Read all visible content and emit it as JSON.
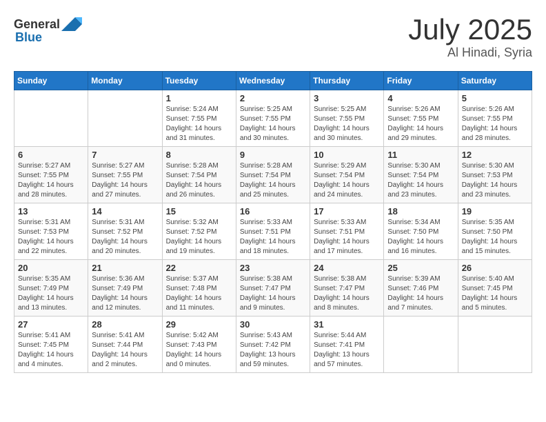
{
  "header": {
    "logo_general": "General",
    "logo_blue": "Blue",
    "month": "July 2025",
    "location": "Al Hinadi, Syria"
  },
  "weekdays": [
    "Sunday",
    "Monday",
    "Tuesday",
    "Wednesday",
    "Thursday",
    "Friday",
    "Saturday"
  ],
  "weeks": [
    [
      {
        "day": "",
        "sunrise": "",
        "sunset": "",
        "daylight": ""
      },
      {
        "day": "",
        "sunrise": "",
        "sunset": "",
        "daylight": ""
      },
      {
        "day": "1",
        "sunrise": "Sunrise: 5:24 AM",
        "sunset": "Sunset: 7:55 PM",
        "daylight": "Daylight: 14 hours and 31 minutes."
      },
      {
        "day": "2",
        "sunrise": "Sunrise: 5:25 AM",
        "sunset": "Sunset: 7:55 PM",
        "daylight": "Daylight: 14 hours and 30 minutes."
      },
      {
        "day": "3",
        "sunrise": "Sunrise: 5:25 AM",
        "sunset": "Sunset: 7:55 PM",
        "daylight": "Daylight: 14 hours and 30 minutes."
      },
      {
        "day": "4",
        "sunrise": "Sunrise: 5:26 AM",
        "sunset": "Sunset: 7:55 PM",
        "daylight": "Daylight: 14 hours and 29 minutes."
      },
      {
        "day": "5",
        "sunrise": "Sunrise: 5:26 AM",
        "sunset": "Sunset: 7:55 PM",
        "daylight": "Daylight: 14 hours and 28 minutes."
      }
    ],
    [
      {
        "day": "6",
        "sunrise": "Sunrise: 5:27 AM",
        "sunset": "Sunset: 7:55 PM",
        "daylight": "Daylight: 14 hours and 28 minutes."
      },
      {
        "day": "7",
        "sunrise": "Sunrise: 5:27 AM",
        "sunset": "Sunset: 7:55 PM",
        "daylight": "Daylight: 14 hours and 27 minutes."
      },
      {
        "day": "8",
        "sunrise": "Sunrise: 5:28 AM",
        "sunset": "Sunset: 7:54 PM",
        "daylight": "Daylight: 14 hours and 26 minutes."
      },
      {
        "day": "9",
        "sunrise": "Sunrise: 5:28 AM",
        "sunset": "Sunset: 7:54 PM",
        "daylight": "Daylight: 14 hours and 25 minutes."
      },
      {
        "day": "10",
        "sunrise": "Sunrise: 5:29 AM",
        "sunset": "Sunset: 7:54 PM",
        "daylight": "Daylight: 14 hours and 24 minutes."
      },
      {
        "day": "11",
        "sunrise": "Sunrise: 5:30 AM",
        "sunset": "Sunset: 7:54 PM",
        "daylight": "Daylight: 14 hours and 23 minutes."
      },
      {
        "day": "12",
        "sunrise": "Sunrise: 5:30 AM",
        "sunset": "Sunset: 7:53 PM",
        "daylight": "Daylight: 14 hours and 23 minutes."
      }
    ],
    [
      {
        "day": "13",
        "sunrise": "Sunrise: 5:31 AM",
        "sunset": "Sunset: 7:53 PM",
        "daylight": "Daylight: 14 hours and 22 minutes."
      },
      {
        "day": "14",
        "sunrise": "Sunrise: 5:31 AM",
        "sunset": "Sunset: 7:52 PM",
        "daylight": "Daylight: 14 hours and 20 minutes."
      },
      {
        "day": "15",
        "sunrise": "Sunrise: 5:32 AM",
        "sunset": "Sunset: 7:52 PM",
        "daylight": "Daylight: 14 hours and 19 minutes."
      },
      {
        "day": "16",
        "sunrise": "Sunrise: 5:33 AM",
        "sunset": "Sunset: 7:51 PM",
        "daylight": "Daylight: 14 hours and 18 minutes."
      },
      {
        "day": "17",
        "sunrise": "Sunrise: 5:33 AM",
        "sunset": "Sunset: 7:51 PM",
        "daylight": "Daylight: 14 hours and 17 minutes."
      },
      {
        "day": "18",
        "sunrise": "Sunrise: 5:34 AM",
        "sunset": "Sunset: 7:50 PM",
        "daylight": "Daylight: 14 hours and 16 minutes."
      },
      {
        "day": "19",
        "sunrise": "Sunrise: 5:35 AM",
        "sunset": "Sunset: 7:50 PM",
        "daylight": "Daylight: 14 hours and 15 minutes."
      }
    ],
    [
      {
        "day": "20",
        "sunrise": "Sunrise: 5:35 AM",
        "sunset": "Sunset: 7:49 PM",
        "daylight": "Daylight: 14 hours and 13 minutes."
      },
      {
        "day": "21",
        "sunrise": "Sunrise: 5:36 AM",
        "sunset": "Sunset: 7:49 PM",
        "daylight": "Daylight: 14 hours and 12 minutes."
      },
      {
        "day": "22",
        "sunrise": "Sunrise: 5:37 AM",
        "sunset": "Sunset: 7:48 PM",
        "daylight": "Daylight: 14 hours and 11 minutes."
      },
      {
        "day": "23",
        "sunrise": "Sunrise: 5:38 AM",
        "sunset": "Sunset: 7:47 PM",
        "daylight": "Daylight: 14 hours and 9 minutes."
      },
      {
        "day": "24",
        "sunrise": "Sunrise: 5:38 AM",
        "sunset": "Sunset: 7:47 PM",
        "daylight": "Daylight: 14 hours and 8 minutes."
      },
      {
        "day": "25",
        "sunrise": "Sunrise: 5:39 AM",
        "sunset": "Sunset: 7:46 PM",
        "daylight": "Daylight: 14 hours and 7 minutes."
      },
      {
        "day": "26",
        "sunrise": "Sunrise: 5:40 AM",
        "sunset": "Sunset: 7:45 PM",
        "daylight": "Daylight: 14 hours and 5 minutes."
      }
    ],
    [
      {
        "day": "27",
        "sunrise": "Sunrise: 5:41 AM",
        "sunset": "Sunset: 7:45 PM",
        "daylight": "Daylight: 14 hours and 4 minutes."
      },
      {
        "day": "28",
        "sunrise": "Sunrise: 5:41 AM",
        "sunset": "Sunset: 7:44 PM",
        "daylight": "Daylight: 14 hours and 2 minutes."
      },
      {
        "day": "29",
        "sunrise": "Sunrise: 5:42 AM",
        "sunset": "Sunset: 7:43 PM",
        "daylight": "Daylight: 14 hours and 0 minutes."
      },
      {
        "day": "30",
        "sunrise": "Sunrise: 5:43 AM",
        "sunset": "Sunset: 7:42 PM",
        "daylight": "Daylight: 13 hours and 59 minutes."
      },
      {
        "day": "31",
        "sunrise": "Sunrise: 5:44 AM",
        "sunset": "Sunset: 7:41 PM",
        "daylight": "Daylight: 13 hours and 57 minutes."
      },
      {
        "day": "",
        "sunrise": "",
        "sunset": "",
        "daylight": ""
      },
      {
        "day": "",
        "sunrise": "",
        "sunset": "",
        "daylight": ""
      }
    ]
  ]
}
